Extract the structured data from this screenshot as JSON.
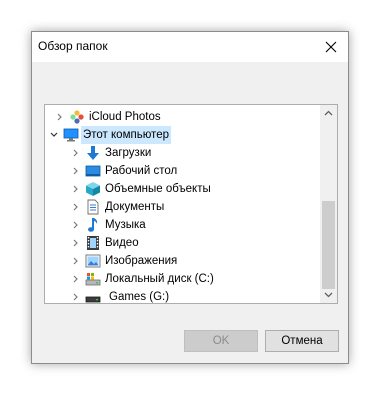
{
  "window": {
    "title": "Обзор папок"
  },
  "tree": {
    "items": [
      {
        "label": "iCloud Photos",
        "icon": "icloud-photos-icon",
        "expanded": false
      },
      {
        "label": "Этот компьютер",
        "icon": "computer-icon",
        "expanded": true,
        "selected": true
      },
      {
        "label": "Загрузки",
        "icon": "downloads-icon"
      },
      {
        "label": "Рабочий стол",
        "icon": "desktop-icon"
      },
      {
        "label": "Объемные объекты",
        "icon": "3d-objects-icon"
      },
      {
        "label": "Документы",
        "icon": "documents-icon"
      },
      {
        "label": "Музыка",
        "icon": "music-icon"
      },
      {
        "label": "Видео",
        "icon": "video-icon"
      },
      {
        "label": "Изображения",
        "icon": "pictures-icon"
      },
      {
        "label": "Локальный диск (C:)",
        "icon": "local-disk-icon"
      },
      {
        "label": "Games (G:)",
        "icon": "drive-icon"
      }
    ]
  },
  "buttons": {
    "ok": "OK",
    "cancel": "Отмена"
  },
  "colors": {
    "selection": "#cce8ff",
    "accent": "#0078d7"
  }
}
